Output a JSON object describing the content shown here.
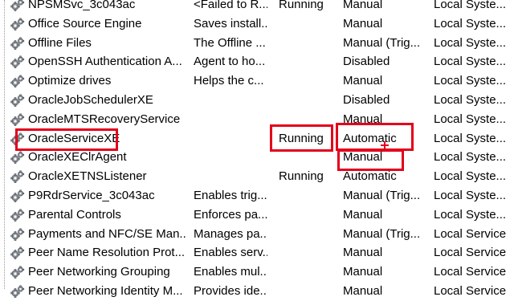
{
  "colors": {
    "highlight": "#e3001b",
    "text": "#000000",
    "background": "#ffffff"
  },
  "service_icon": "gear-icon",
  "services": [
    {
      "name": "NPSMSvc_3c043ac",
      "description": "<Failed to R...",
      "status": "Running",
      "startup": "Manual",
      "logon": "Local Syste..."
    },
    {
      "name": "Office Source Engine",
      "description": "Saves install...",
      "status": "",
      "startup": "Manual",
      "logon": "Local Syste..."
    },
    {
      "name": "Offline Files",
      "description": "The Offline ...",
      "status": "",
      "startup": "Manual (Trig...",
      "logon": "Local Syste..."
    },
    {
      "name": "OpenSSH Authentication A...",
      "description": "Agent to ho...",
      "status": "",
      "startup": "Disabled",
      "logon": "Local Syste..."
    },
    {
      "name": "Optimize drives",
      "description": "Helps the c...",
      "status": "",
      "startup": "Manual",
      "logon": "Local Syste..."
    },
    {
      "name": "OracleJobSchedulerXE",
      "description": "",
      "status": "",
      "startup": "Disabled",
      "logon": "Local Syste..."
    },
    {
      "name": "OracleMTSRecoveryService",
      "description": "",
      "status": "",
      "startup": "Manual",
      "logon": "Local Syste..."
    },
    {
      "name": "OracleServiceXE",
      "description": "",
      "status": "Running",
      "startup": "Automatic",
      "logon": "Local Syste..."
    },
    {
      "name": "OracleXEClrAgent",
      "description": "",
      "status": "",
      "startup": "Manual",
      "logon": "Local Syste..."
    },
    {
      "name": "OracleXETNSListener",
      "description": "",
      "status": "Running",
      "startup": "Automatic",
      "logon": "Local Syste..."
    },
    {
      "name": "P9RdrService_3c043ac",
      "description": "Enables trig...",
      "status": "",
      "startup": "Manual (Trig...",
      "logon": "Local Syste..."
    },
    {
      "name": "Parental Controls",
      "description": "Enforces pa...",
      "status": "",
      "startup": "Manual",
      "logon": "Local Syste..."
    },
    {
      "name": "Payments and NFC/SE Man...",
      "description": "Manages pa...",
      "status": "",
      "startup": "Manual (Trig...",
      "logon": "Local Service"
    },
    {
      "name": "Peer Name Resolution Prot...",
      "description": "Enables serv...",
      "status": "",
      "startup": "Manual",
      "logon": "Local Service"
    },
    {
      "name": "Peer Networking Grouping",
      "description": "Enables mul...",
      "status": "",
      "startup": "Manual",
      "logon": "Local Service"
    },
    {
      "name": "Peer Networking Identity M...",
      "description": "Provides ide...",
      "status": "",
      "startup": "Manual",
      "logon": "Local Service"
    }
  ]
}
